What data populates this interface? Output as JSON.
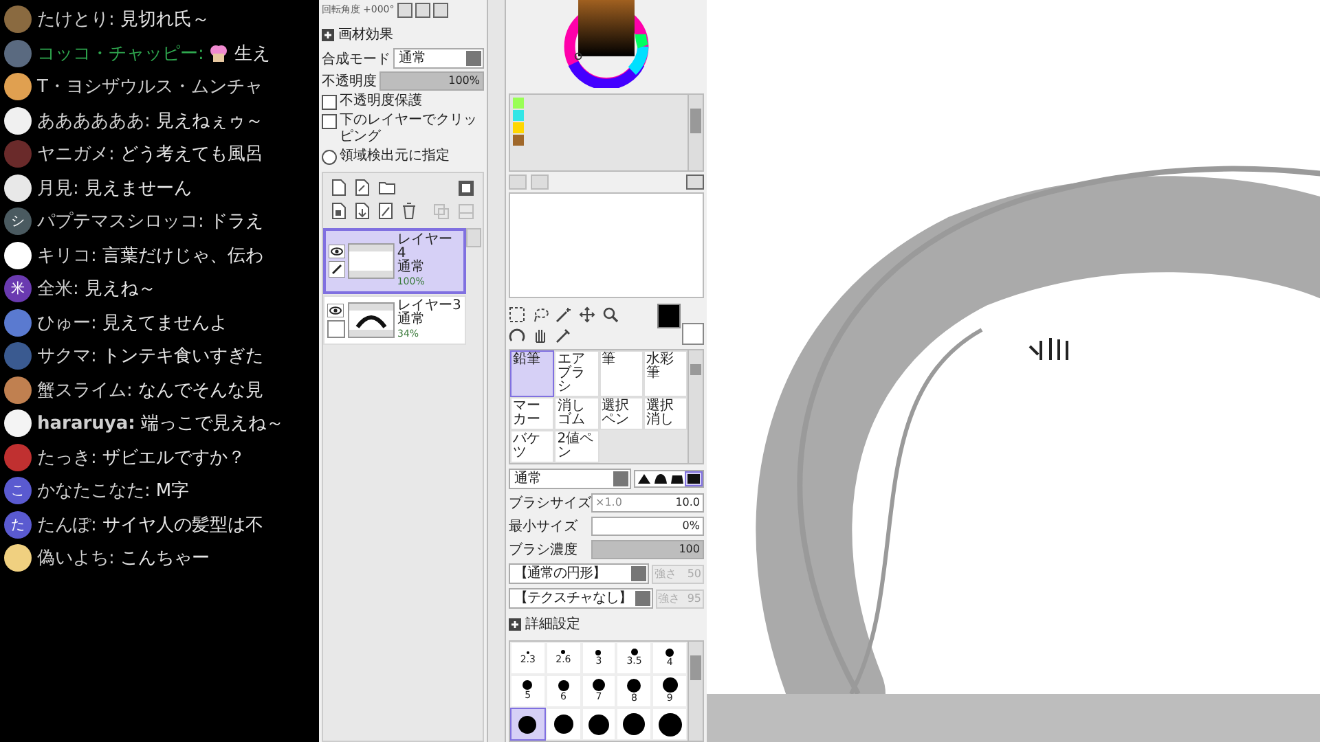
{
  "chat": [
    {
      "author": "たけとり:",
      "message": "見切れ氏～",
      "color": "#d0d0d0",
      "bold": false,
      "sticker": false,
      "avatar": {
        "color": "#8a6a40"
      }
    },
    {
      "author": "コッコ・チャッピー:",
      "message": "生え",
      "color": "#2fa84f",
      "bold": false,
      "sticker": true,
      "avatar": {
        "color": "#5a6a80"
      }
    },
    {
      "author": "T・ヨシザウルス・ムンチャ",
      "color": "#d0d0d0",
      "bold": false,
      "sticker": false,
      "avatar": {
        "color": "#e0a050"
      }
    },
    {
      "author": "ああああああ:",
      "message": "見えねぇゥ～",
      "color": "#d0d0d0",
      "bold": false,
      "sticker": false,
      "avatar": {
        "color": "#f0f0f0"
      }
    },
    {
      "author": "ヤニガメ:",
      "message": "どう考えても風呂",
      "color": "#d0d0d0",
      "bold": false,
      "sticker": false,
      "avatar": {
        "color": "#6a2a2a"
      }
    },
    {
      "author": "月見:",
      "message": "見えませーん",
      "color": "#d0d0d0",
      "bold": false,
      "sticker": false,
      "avatar": {
        "color": "#e8e8e8"
      }
    },
    {
      "author": "パプテマスシロッコ:",
      "message": "ドラえ",
      "color": "#d0d0d0",
      "bold": false,
      "sticker": false,
      "avatar": {
        "color": "#4a5a60",
        "letter": "シ"
      }
    },
    {
      "author": "キリコ:",
      "message": "言葉だけじゃ、伝わ",
      "color": "#d0d0d0",
      "bold": false,
      "sticker": false,
      "avatar": {
        "color": "#ffffff"
      }
    },
    {
      "author": "全米:",
      "message": "見えね～",
      "color": "#d0d0d0",
      "bold": false,
      "sticker": false,
      "avatar": {
        "color": "#6a3ab0",
        "letter": "米"
      }
    },
    {
      "author": "ひゅー:",
      "message": "見えてませんよ",
      "color": "#d0d0d0",
      "bold": false,
      "sticker": false,
      "avatar": {
        "color": "#5a7ad0"
      }
    },
    {
      "author": "サクマ:",
      "message": "トンテキ食いすぎた",
      "color": "#d0d0d0",
      "bold": false,
      "sticker": false,
      "avatar": {
        "color": "#3a5a90"
      }
    },
    {
      "author": "蟹スライム:",
      "message": "なんでそんな見",
      "color": "#d0d0d0",
      "bold": false,
      "sticker": false,
      "avatar": {
        "color": "#c08050"
      }
    },
    {
      "author": "hararuya:",
      "message": "端っこで見えね～",
      "color": "#d0d0d0",
      "bold": true,
      "sticker": false,
      "avatar": {
        "color": "#f4f4f4"
      }
    },
    {
      "author": "たっき:",
      "message": "ザビエルですか？",
      "color": "#d0d0d0",
      "bold": false,
      "sticker": false,
      "avatar": {
        "color": "#c03030"
      }
    },
    {
      "author": "かなたこなた:",
      "message": "M字",
      "color": "#d0d0d0",
      "bold": false,
      "sticker": false,
      "avatar": {
        "color": "#5a5ad0",
        "letter": "こ"
      }
    },
    {
      "author": "たんぽ:",
      "message": "サイヤ人の髪型は不",
      "color": "#d0d0d0",
      "bold": false,
      "sticker": false,
      "avatar": {
        "color": "#5a5ad0",
        "letter": "た"
      }
    },
    {
      "author": "偽いよち:",
      "message": "こんちゃー",
      "color": "#d0d0d0",
      "bold": false,
      "sticker": false,
      "avatar": {
        "color": "#f0d080"
      }
    }
  ],
  "layer_panel": {
    "rotation_label": "回転角度",
    "rotation_value": "+000°",
    "effects_header": "画材効果",
    "blend_label": "合成モード",
    "blend_value": "通常",
    "opacity_label": "不透明度",
    "opacity": {
      "level": 1,
      "reading": "100%"
    },
    "options": [
      {
        "kind": "checkbox",
        "label": "不透明度保護",
        "checked": false
      },
      {
        "kind": "checkbox",
        "label": "下のレイヤーでクリッピング",
        "checked": false
      },
      {
        "kind": "radio",
        "label": "領域検出元に指定",
        "checked": false
      }
    ],
    "layers": [
      {
        "name": "レイヤー4",
        "mode": "通常",
        "opacity": "100%",
        "selected": true,
        "visible": true,
        "kind": "blank"
      },
      {
        "name": "レイヤー3",
        "mode": "通常",
        "opacity": "34%",
        "selected": false,
        "visible": true,
        "kind": "arc"
      }
    ]
  },
  "color_panel": {
    "swatches": [
      {
        "color": "#99ff55"
      },
      {
        "color": "#33e6e6"
      },
      {
        "color": "#ffd700"
      },
      {
        "color": "#a0682a"
      }
    ],
    "primary": {
      "color": "#000000"
    },
    "secondary": {
      "color": "#ffffff"
    }
  },
  "brushes": [
    {
      "label": "鉛筆",
      "selected": true
    },
    {
      "label": "エアブラシ",
      "selected": false
    },
    {
      "label": "筆",
      "selected": false
    },
    {
      "label": "水彩筆",
      "selected": false
    },
    {
      "label": "マーカー",
      "selected": false
    },
    {
      "label": "消しゴム",
      "selected": false
    },
    {
      "label": "選択ペン",
      "selected": false
    },
    {
      "label": "選択消し",
      "selected": false
    },
    {
      "label": "バケツ",
      "selected": false
    },
    {
      "label": "2値ペン",
      "selected": false
    }
  ],
  "brush_settings": {
    "mode": "通常",
    "tip_shapes": [
      {
        "selected": false
      },
      {
        "selected": false
      },
      {
        "selected": false
      },
      {
        "selected": true
      }
    ],
    "size_label": "ブラシサイズ",
    "size_multiplier": "×1.0",
    "size_value": "10.0",
    "min_size_label": "最小サイズ",
    "min_size_value": "0%",
    "density_label": "ブラシ濃度",
    "density": {
      "level": 1,
      "reading": "100"
    },
    "shape_value": "【通常の円形】",
    "shape_strength_label": "強さ",
    "shape_strength": "50",
    "texture_value": "【テクスチャなし】",
    "texture_strength_label": "強さ",
    "texture_strength": "95",
    "detail_label": "詳細設定",
    "size_presets": [
      {
        "label": "2.3",
        "selected": false
      },
      {
        "label": "2.6",
        "selected": false
      },
      {
        "label": "3",
        "selected": false
      },
      {
        "label": "3.5",
        "selected": false
      },
      {
        "label": "4",
        "selected": false
      },
      {
        "label": "5",
        "selected": false
      },
      {
        "label": "6",
        "selected": false
      },
      {
        "label": "7",
        "selected": false
      },
      {
        "label": "8",
        "selected": false
      },
      {
        "label": "9",
        "selected": false
      },
      {
        "selected": true
      },
      {
        "selected": false
      },
      {
        "selected": false
      },
      {
        "selected": false
      },
      {
        "selected": false
      }
    ]
  }
}
